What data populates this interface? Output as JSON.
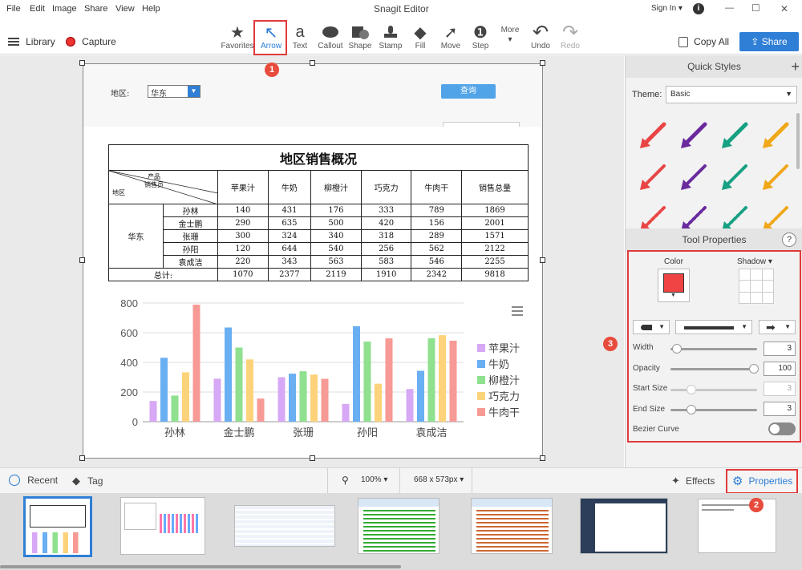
{
  "titlebar": {
    "menus": [
      "File",
      "Edit",
      "Image",
      "Share",
      "View",
      "Help"
    ],
    "title": "Snagit Editor",
    "signin": "Sign In ▾",
    "info_icon": "info-icon",
    "minimize": "—",
    "maximize": "☐",
    "close": "✕"
  },
  "toolbar": {
    "library": "Library",
    "capture": "Capture",
    "tools": [
      {
        "id": "favorites",
        "label": "Favorites",
        "icon": "★"
      },
      {
        "id": "arrow",
        "label": "Arrow",
        "icon": "↖"
      },
      {
        "id": "text",
        "label": "Text",
        "icon": "a"
      },
      {
        "id": "callout",
        "label": "Callout",
        "icon": "💬"
      },
      {
        "id": "shape",
        "label": "Shape",
        "icon": "■"
      },
      {
        "id": "stamp",
        "label": "Stamp",
        "icon": "⊥"
      },
      {
        "id": "fill",
        "label": "Fill",
        "icon": "◆"
      },
      {
        "id": "move",
        "label": "Move",
        "icon": "➚"
      },
      {
        "id": "step",
        "label": "Step",
        "icon": "❶"
      },
      {
        "id": "more",
        "label": "More",
        "icon": "▾"
      },
      {
        "id": "undo",
        "label": "Undo",
        "icon": "↶"
      },
      {
        "id": "redo",
        "label": "Redo",
        "icon": "↷"
      }
    ],
    "copy_all": "Copy All",
    "share": "Share"
  },
  "badges": {
    "b1": "1",
    "b2": "2",
    "b3": "3"
  },
  "canvas": {
    "region_label": "地区:",
    "region_value": "华东",
    "query_button": "查询",
    "table_title": "地区销售概况",
    "corner_product": "产品",
    "corner_sales": "销售员",
    "corner_region": "地区",
    "columns": [
      "苹果汁",
      "牛奶",
      "柳橙汁",
      "巧克力",
      "牛肉干",
      "销售总量"
    ],
    "region_cell": "华东",
    "rows": [
      {
        "name": "孙林",
        "vals": [
          "140",
          "431",
          "176",
          "333",
          "789",
          "1869"
        ]
      },
      {
        "name": "金士鹏",
        "vals": [
          "290",
          "635",
          "500",
          "420",
          "156",
          "2001"
        ]
      },
      {
        "name": "张珊",
        "vals": [
          "300",
          "324",
          "340",
          "318",
          "289",
          "1571"
        ]
      },
      {
        "name": "孙阳",
        "vals": [
          "120",
          "644",
          "540",
          "256",
          "562",
          "2122"
        ]
      },
      {
        "name": "袁成洁",
        "vals": [
          "220",
          "343",
          "563",
          "583",
          "546",
          "2255"
        ]
      }
    ],
    "total_label": "总计:",
    "totals": [
      "1070",
      "2377",
      "2119",
      "1910",
      "2342",
      "9818"
    ]
  },
  "chart_data": {
    "type": "bar",
    "categories": [
      "孙林",
      "金士鹏",
      "张珊",
      "孙阳",
      "袁成洁"
    ],
    "series": [
      {
        "name": "苹果汁",
        "values": [
          140,
          290,
          300,
          120,
          220
        ],
        "color": "#d7a8f5"
      },
      {
        "name": "牛奶",
        "values": [
          431,
          635,
          324,
          644,
          343
        ],
        "color": "#6aaff2"
      },
      {
        "name": "柳橙汁",
        "values": [
          176,
          500,
          340,
          540,
          563
        ],
        "color": "#8fe08f"
      },
      {
        "name": "巧克力",
        "values": [
          333,
          420,
          318,
          256,
          583
        ],
        "color": "#fcd37a"
      },
      {
        "name": "牛肉干",
        "values": [
          789,
          156,
          289,
          562,
          546
        ],
        "color": "#f79a95"
      }
    ],
    "yticks": [
      "0",
      "200",
      "400",
      "600",
      "800"
    ],
    "ylim": [
      0,
      800
    ],
    "grid": true,
    "legend": "right"
  },
  "quick_styles": {
    "title": "Quick Styles",
    "add": "+",
    "theme_label": "Theme:",
    "theme_value": "Basic"
  },
  "tool_properties": {
    "title": "Tool Properties",
    "help": "?",
    "color_label": "Color",
    "color_value": "#f04343",
    "shadow_label": "Shadow ▾",
    "width_label": "Width",
    "width_value": "3",
    "opacity_label": "Opacity",
    "opacity_value": "100",
    "start_size_label": "Start Size",
    "start_size_value": "3",
    "end_size_label": "End Size",
    "end_size_value": "3",
    "bezier_label": "Bezier Curve"
  },
  "bottombar": {
    "recent": "Recent",
    "tag": "Tag",
    "zoom": "100% ▾",
    "size": "668 x 573px ▾",
    "effects": "Effects",
    "properties": "Properties"
  }
}
